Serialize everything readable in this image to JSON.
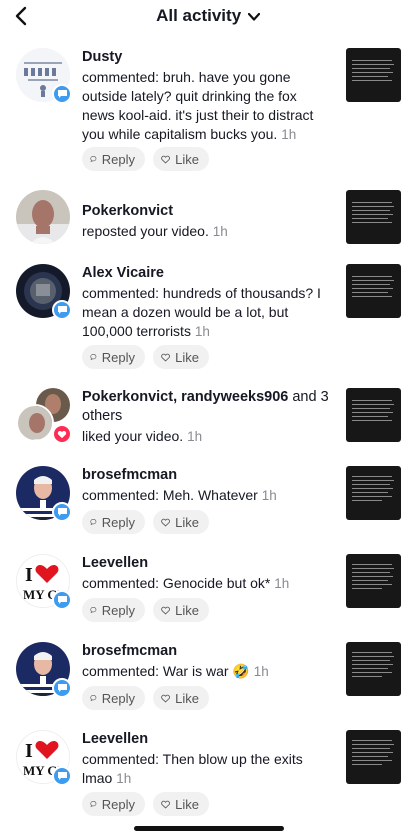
{
  "header": {
    "title": "All activity"
  },
  "actions": {
    "reply_label": "Reply",
    "like_label": "Like"
  },
  "items": [
    {
      "name": "Dusty",
      "text": "commented: bruh. have you gone outside lately? quit drinking the fox news kool-aid. it's just their to distract you while capitalism bucks you.",
      "time": "1h"
    },
    {
      "name": "Pokerkonvict",
      "text": "reposted your video.",
      "time": "1h"
    },
    {
      "name": "Alex Vicaire",
      "text": "commented: hundreds of thousands? I mean a dozen would be a lot, but 100,000 terrorists",
      "time": "1h"
    },
    {
      "name": "Pokerkonvict, randyweeks906",
      "name_suffix": " and 3 others",
      "text": "liked your video.",
      "time": "1h"
    },
    {
      "name": "brosefmcman",
      "text": "commented: Meh. Whatever",
      "time": "1h"
    },
    {
      "name": "Leevellen",
      "text": "commented: Genocide but ok*",
      "time": "1h"
    },
    {
      "name": "brosefmcman",
      "text": "commented: War is war 🤣",
      "time": "1h"
    },
    {
      "name": "Leevellen",
      "text": "commented: Then blow up the exits lmao",
      "time": "1h"
    }
  ],
  "icons": {
    "back": "chevron-left-icon",
    "dropdown": "chevron-down-icon",
    "reply": "speech-bubble-icon",
    "like": "heart-icon",
    "comment_badge": "comment-badge-icon",
    "like_badge": "heart-badge-icon"
  },
  "colors": {
    "comment_badge": "#3d9bf0",
    "like_badge": "#fe2c55",
    "pill_bg": "#f1f1f2",
    "time_text": "#8a8b91"
  }
}
